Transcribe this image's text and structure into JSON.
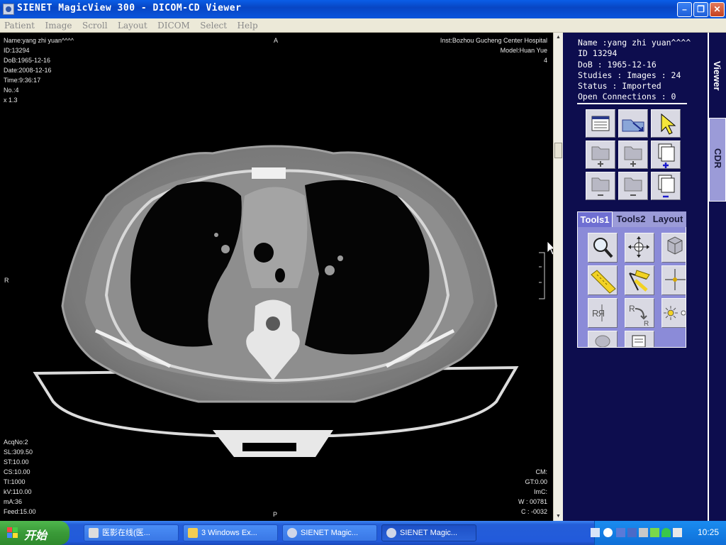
{
  "window": {
    "title": "SIENET MagicView 300  - DICOM-CD Viewer"
  },
  "menu": [
    "Patient",
    "Image",
    "Scroll",
    "Layout",
    "DICOM",
    "Select",
    "Help"
  ],
  "overlay": {
    "top_left": [
      "Name:yang zhi yuan^^^^",
      "ID:13294",
      "DoB:1965-12-16",
      "Date:2008-12-16",
      "Time:9:36:17",
      "No.:4",
      "x 1.3"
    ],
    "top_center": "A",
    "top_right": [
      "Inst:Bozhou Gucheng Center Hospital",
      "Model:Huan Yue",
      "4"
    ],
    "left_mid": "R",
    "bottom_center": "P",
    "bottom_left": [
      "AcqNo:2",
      "SL:309.50",
      "ST:10.00",
      "CS:10.00",
      "TI:1000",
      "kV:110.00",
      "mA:36",
      "Feed:15.00"
    ],
    "bottom_right": [
      "CM:",
      "GT:0.00",
      "ImC:",
      "W : 00781",
      "C : -0032"
    ]
  },
  "patient_info": {
    "name": "Name :yang zhi yuan^^^^",
    "id": "ID 13294",
    "dob": "DoB : 1965-12-16",
    "studies": "Studies : Images : 24",
    "status": "Status : Imported",
    "connections": "Open Connections : 0"
  },
  "tool_tabs": [
    "Tools1",
    "Tools2",
    "Layout"
  ],
  "side_tabs": [
    "Viewer",
    "CDR"
  ],
  "taskbar": {
    "start": "开始",
    "tasks": [
      "医影在线(医...",
      "3 Windows Ex...",
      "SIENET Magic...",
      "SIENET Magic..."
    ],
    "clock": "10:25"
  },
  "colors": {
    "panel_bg": "#0d0d4e",
    "tab_bg": "#9b9bd8",
    "tab_active": "#6f6fd2",
    "titlebar": "#0846c4"
  }
}
